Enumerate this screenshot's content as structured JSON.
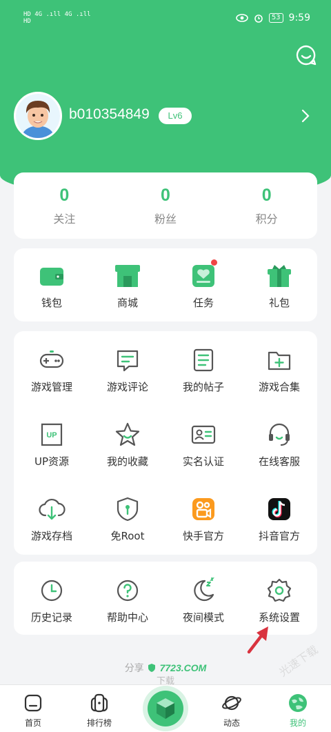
{
  "status_bar": {
    "left_row1": "HD 4G .ıll 4G .ıll",
    "left_row2": "HD",
    "battery": "53",
    "time": "9:59"
  },
  "header": {
    "chat_icon": "message-smile-icon",
    "username": "b010354849",
    "level": "Lv6",
    "arrow_icon": "chevron-right-icon"
  },
  "stats": [
    {
      "value": "0",
      "label": "关注"
    },
    {
      "value": "0",
      "label": "粉丝"
    },
    {
      "value": "0",
      "label": "积分"
    }
  ],
  "wallet_row": [
    {
      "label": "钱包",
      "icon": "wallet-icon"
    },
    {
      "label": "商城",
      "icon": "shop-icon"
    },
    {
      "label": "任务",
      "icon": "task-icon",
      "has_dot": true
    },
    {
      "label": "礼包",
      "icon": "gift-icon"
    }
  ],
  "tools": [
    {
      "label": "游戏管理",
      "icon": "gamepad-icon"
    },
    {
      "label": "游戏评论",
      "icon": "comment-icon"
    },
    {
      "label": "我的帖子",
      "icon": "post-icon"
    },
    {
      "label": "游戏合集",
      "icon": "folder-add-icon"
    },
    {
      "label": "UP资源",
      "icon": "up-resource-icon"
    },
    {
      "label": "我的收藏",
      "icon": "star-icon"
    },
    {
      "label": "实名认证",
      "icon": "id-card-icon"
    },
    {
      "label": "在线客服",
      "icon": "headset-icon"
    },
    {
      "label": "游戏存档",
      "icon": "cloud-download-icon"
    },
    {
      "label": "免Root",
      "icon": "shield-icon"
    },
    {
      "label": "快手官方",
      "icon": "kuaishou-icon"
    },
    {
      "label": "抖音官方",
      "icon": "douyin-icon"
    }
  ],
  "misc": [
    {
      "label": "历史记录",
      "icon": "clock-icon"
    },
    {
      "label": "帮助中心",
      "icon": "help-icon"
    },
    {
      "label": "夜间模式",
      "icon": "moon-icon"
    },
    {
      "label": "系统设置",
      "icon": "gear-icon"
    }
  ],
  "share": {
    "prefix": "分享",
    "brand": "7723.COM",
    "line2": "下载"
  },
  "tabs": [
    {
      "label": "首页",
      "icon": "home-icon"
    },
    {
      "label": "排行榜",
      "icon": "ranking-icon"
    },
    {
      "label": "",
      "icon": "cube-icon"
    },
    {
      "label": "动态",
      "icon": "planet-icon"
    },
    {
      "label": "我的",
      "icon": "profile-globe-icon"
    }
  ],
  "colors": {
    "accent": "#3ec278",
    "background": "#f3f4f6",
    "badge_dot": "#ef4545",
    "annotation_arrow": "#d9333f"
  }
}
